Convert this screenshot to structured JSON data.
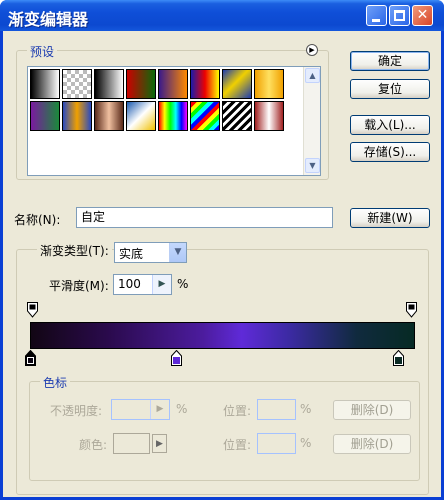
{
  "window": {
    "title": "渐变编辑器"
  },
  "presets": {
    "legend": "预设"
  },
  "buttons": {
    "ok": "确定",
    "reset": "复位",
    "load": "载入(L)...",
    "save": "存储(S)...",
    "new": "新建(W)",
    "delete_opacity": "删除(D)",
    "delete_color": "删除(D)"
  },
  "name_row": {
    "label": "名称(N):",
    "value": "自定"
  },
  "gradient": {
    "type_label": "渐变类型(T):",
    "type_value": "实底",
    "smoothness_label": "平滑度(M):",
    "smoothness_value": "100",
    "smoothness_unit": "%",
    "color_stops": [
      "#0c0612",
      "#5f2ad8",
      "#0a2a24"
    ],
    "opacity_stops": [
      100,
      100
    ]
  },
  "stops_panel": {
    "legend": "色标",
    "opacity_label": "不透明度:",
    "opacity_unit": "%",
    "opacity_location_label": "位置:",
    "opacity_location_unit": "%",
    "color_label": "颜色:",
    "color_location_label": "位置:",
    "color_location_unit": "%"
  }
}
